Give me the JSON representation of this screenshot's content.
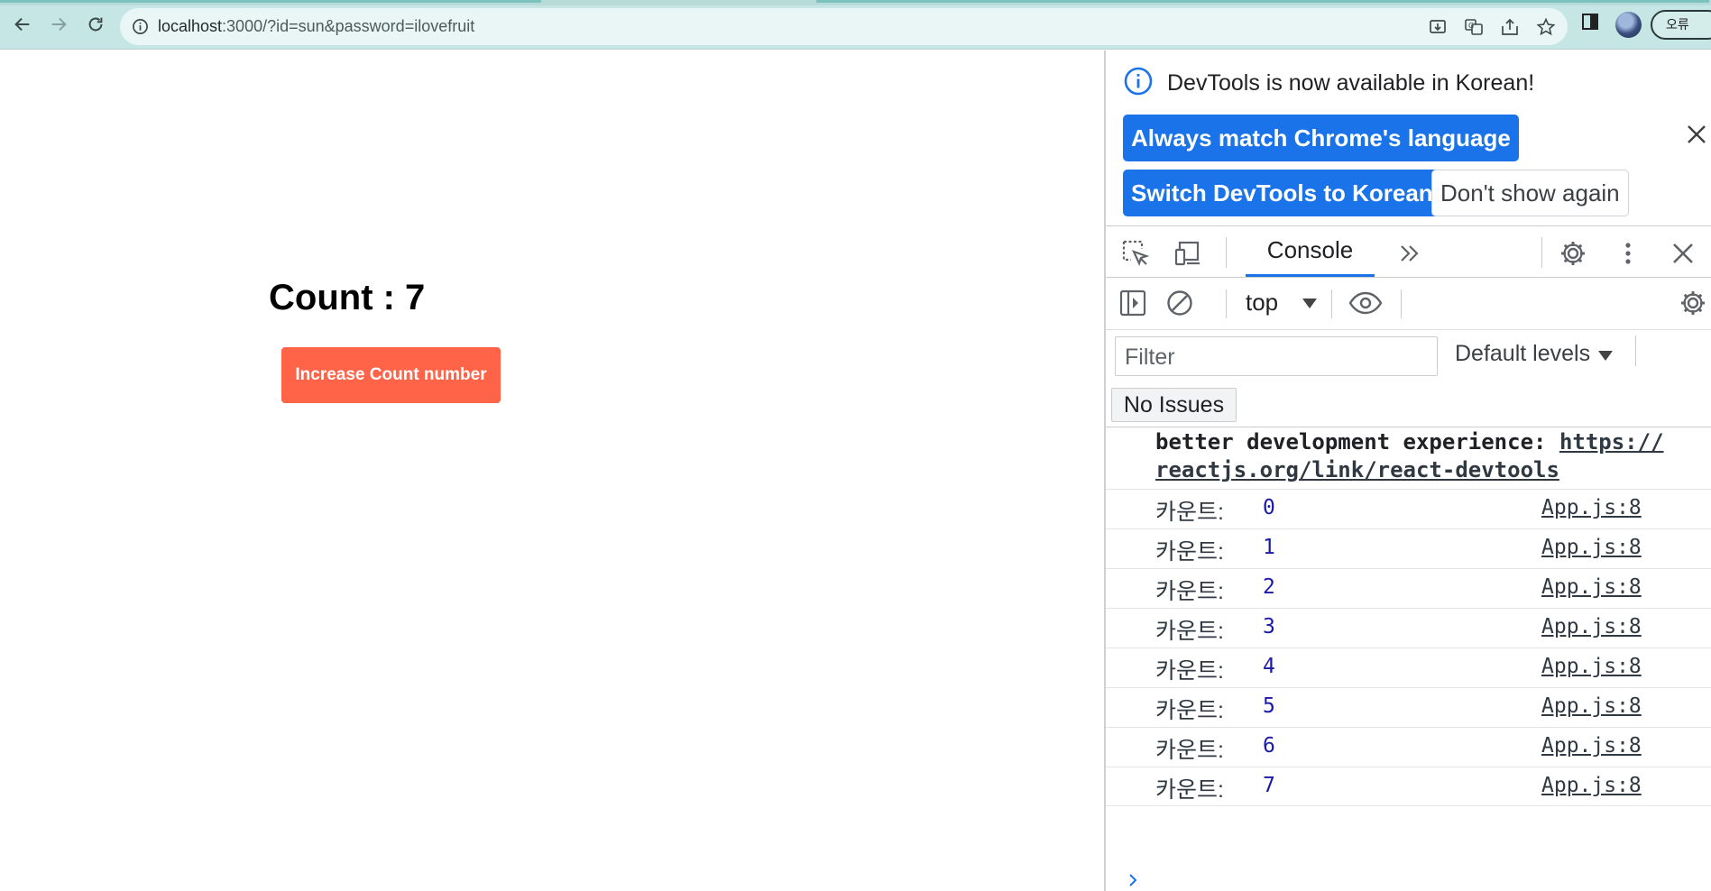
{
  "browser": {
    "url_host": "localhost",
    "url_rest": ":3000/?id=sun&password=ilovefruit",
    "profile_badge": "오류"
  },
  "page": {
    "count_text": "Count : 7",
    "button_label": "Increase Count number",
    "button_color": "#ff6348"
  },
  "devtools": {
    "banner": {
      "message": "DevTools is now available in Korean!",
      "btn_match": "Always match Chrome's language",
      "btn_switch": "Switch DevTools to Korean",
      "btn_dont": "Don't show again"
    },
    "tabs": {
      "console": "Console"
    },
    "context": "top",
    "filter_placeholder": "Filter",
    "levels": "Default levels",
    "issues": "No Issues",
    "warning": {
      "text": "better development experience: ",
      "link1": "https://",
      "link2": "reactjs.org/link/react-devtools"
    },
    "logs": [
      {
        "label": "카운트:",
        "value": "0",
        "source": "App.js:8"
      },
      {
        "label": "카운트:",
        "value": "1",
        "source": "App.js:8"
      },
      {
        "label": "카운트:",
        "value": "2",
        "source": "App.js:8"
      },
      {
        "label": "카운트:",
        "value": "3",
        "source": "App.js:8"
      },
      {
        "label": "카운트:",
        "value": "4",
        "source": "App.js:8"
      },
      {
        "label": "카운트:",
        "value": "5",
        "source": "App.js:8"
      },
      {
        "label": "카운트:",
        "value": "6",
        "source": "App.js:8"
      },
      {
        "label": "카운트:",
        "value": "7",
        "source": "App.js:8"
      }
    ],
    "accent": "#1a73e8"
  }
}
